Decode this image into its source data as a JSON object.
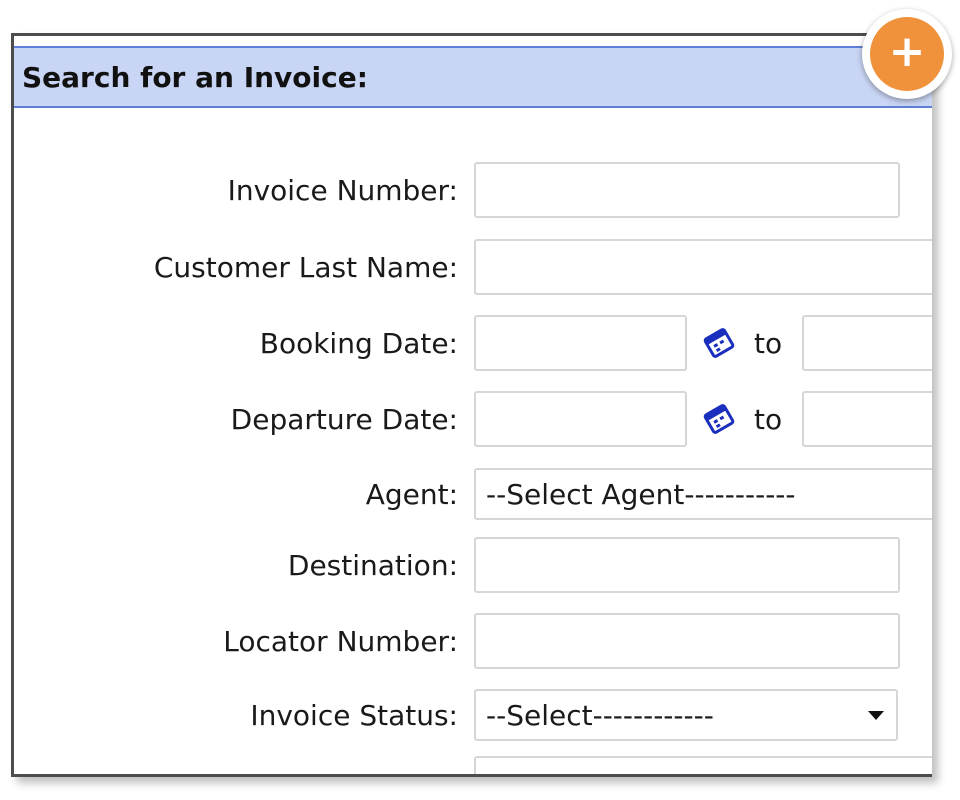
{
  "panel": {
    "title": "Search for an Invoice:"
  },
  "fields": {
    "invoice_number": {
      "label": "Invoice Number:",
      "value": ""
    },
    "customer_last_name": {
      "label": "Customer Last Name:",
      "value": ""
    },
    "booking_date": {
      "label": "Booking Date:",
      "from": "",
      "to_label": "to",
      "to": ""
    },
    "departure_date": {
      "label": "Departure Date:",
      "from": "",
      "to_label": "to",
      "to": ""
    },
    "agent": {
      "label": "Agent:",
      "selected": "--Select Agent-----------"
    },
    "destination": {
      "label": "Destination:",
      "value": ""
    },
    "locator_number": {
      "label": "Locator Number:",
      "value": ""
    },
    "invoice_status": {
      "label": "Invoice Status:",
      "selected": "--Select------------"
    }
  },
  "add_button": {
    "symbol": "+"
  },
  "icons": {
    "calendar": "calendar-icon",
    "dropdown": "chevron-down-icon",
    "add": "plus-icon"
  },
  "colors": {
    "header_bg": "#c9d5f4",
    "header_border": "#5d7fd8",
    "accent_orange": "#f0923c"
  }
}
